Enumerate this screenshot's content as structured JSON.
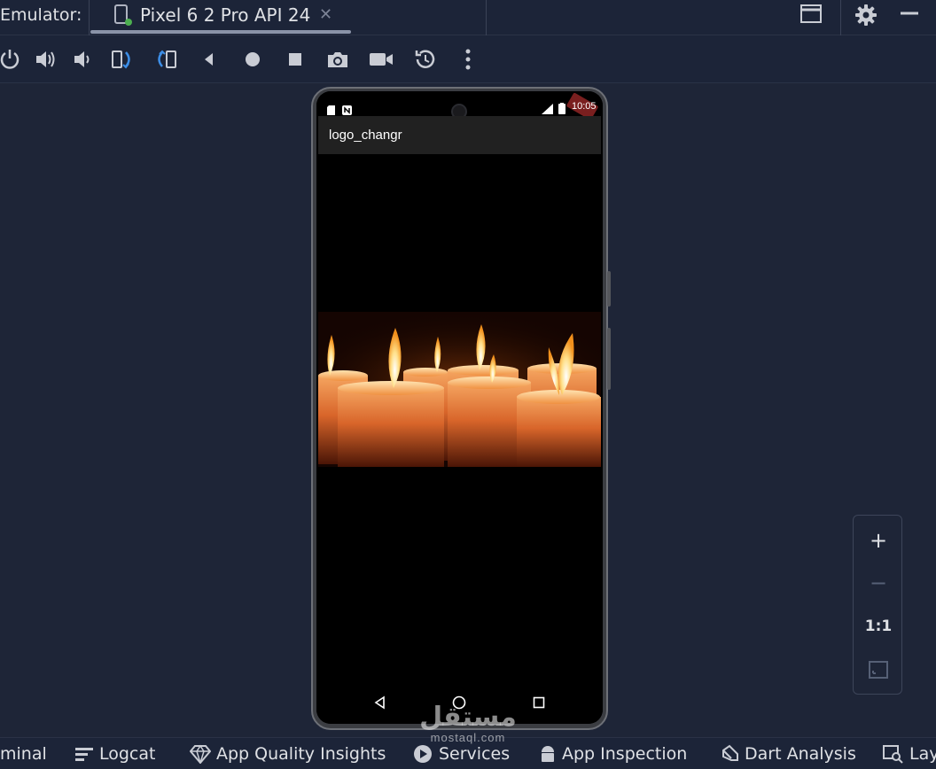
{
  "titlebar": {
    "label": "Emulator:",
    "tab_title": "Pixel 6 2 Pro API 24",
    "tab_close": "✕"
  },
  "toolbar": {
    "buttons": [
      "power-icon",
      "volume-up-icon",
      "volume-down-icon",
      "rotate-left-icon",
      "rotate-right-icon",
      "back-icon",
      "home-icon",
      "overview-icon",
      "screenshot-icon",
      "screen-record-icon",
      "snapshot-icon",
      "more-icon"
    ]
  },
  "device": {
    "status_time": "10:05",
    "app_title": "logo_changr"
  },
  "zoom": {
    "zoom_in": "+",
    "zoom_out": "−",
    "actual_size": "1:1"
  },
  "bottombar": {
    "terminal": "minal",
    "logcat": "Logcat",
    "app_quality": "App Quality Insights",
    "services": "Services",
    "app_inspection": "App Inspection",
    "dart_analysis": "Dart Analysis",
    "layout": "Lay"
  },
  "watermark": {
    "arabic": "مستقل",
    "latin": "mostaql.com"
  },
  "colors": {
    "background": "#1e2537",
    "bar": "#1c2438",
    "text": "#dfe1e5",
    "accent_blue": "#3d8ee6",
    "candle_orange": "#e0782a"
  }
}
